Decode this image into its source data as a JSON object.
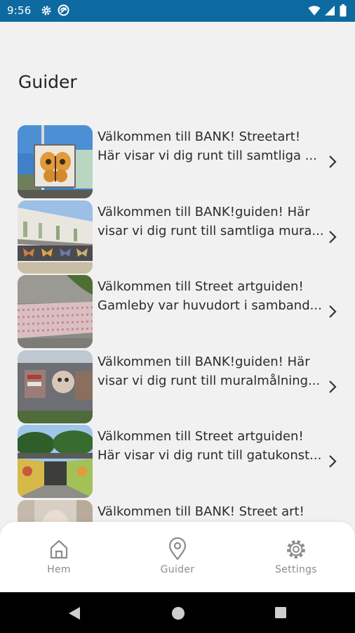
{
  "status_bar": {
    "time": "9:56",
    "left_icons": [
      "gear-icon",
      "vpn-icon"
    ],
    "right_icons": [
      "wifi-icon",
      "signal-icon",
      "battery-icon"
    ],
    "background_color": "#0d6aa0"
  },
  "header": {
    "title": "Guider"
  },
  "guides": [
    {
      "line1": "Välkommen till BANK! Streetart!",
      "line2": "Här visar vi dig runt till samtliga ..."
    },
    {
      "line1": "Välkommen till BANK!guiden! Här",
      "line2": "visar vi dig runt till samtliga mura..."
    },
    {
      "line1": "Välkommen till Street artguiden!",
      "line2": "Gamleby var huvudort i samband..."
    },
    {
      "line1": "Välkommen till BANK!guiden! Här",
      "line2": "visar vi dig runt till muralmålning..."
    },
    {
      "line1": "Välkommen till Street artguiden!",
      "line2": "Här visar vi dig runt till gatukonst..."
    },
    {
      "line1": "Välkommen till BANK! Street art!",
      "line2": ""
    }
  ],
  "bottom_nav": {
    "items": [
      {
        "label": "Hem",
        "icon": "home-icon"
      },
      {
        "label": "Guider",
        "icon": "map-pin-icon"
      },
      {
        "label": "Settings",
        "icon": "gear-icon"
      }
    ]
  },
  "system_nav": {
    "buttons": [
      "back-icon",
      "home-circle-icon",
      "recents-icon"
    ]
  }
}
